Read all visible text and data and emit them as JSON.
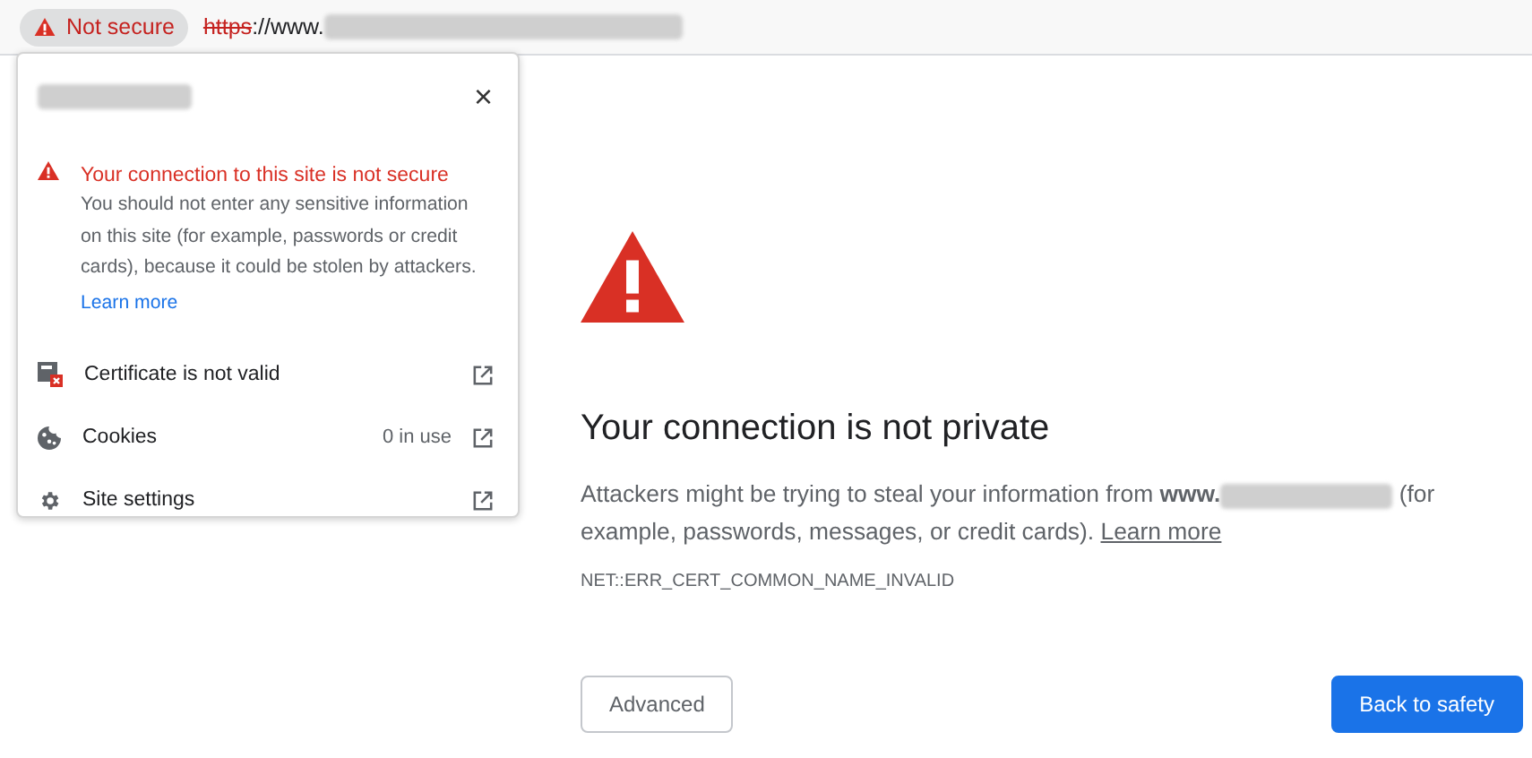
{
  "address_bar": {
    "security_chip": "Not secure",
    "url_scheme": "https",
    "url_rest": "://www."
  },
  "popup": {
    "close": "×",
    "warning_title": "Your connection to this site is not secure",
    "warning_text": "You should not enter any sensitive information on this site (for example, passwords or credit cards), because it could be stolen by attackers.",
    "learn_more": "Learn more",
    "items": [
      {
        "kind": "certificate",
        "label": "Certificate is not valid"
      },
      {
        "kind": "cookies",
        "label": "Cookies",
        "count": "0 in use"
      },
      {
        "kind": "settings",
        "label": "Site settings"
      }
    ]
  },
  "page": {
    "heading": "Your connection is not private",
    "body_start": "Attackers might be trying to steal your information from **www.**",
    "body_end": " (for example, passwords, messages, or credit cards). ",
    "learn_more": "Learn more",
    "error_code": "NET::ERR_CERT_COMMON_NAME_INVALID",
    "buttons": [
      {
        "kind": "secondary",
        "label": "Advanced"
      },
      {
        "kind": "primary",
        "label": "Back to safety"
      }
    ]
  }
}
